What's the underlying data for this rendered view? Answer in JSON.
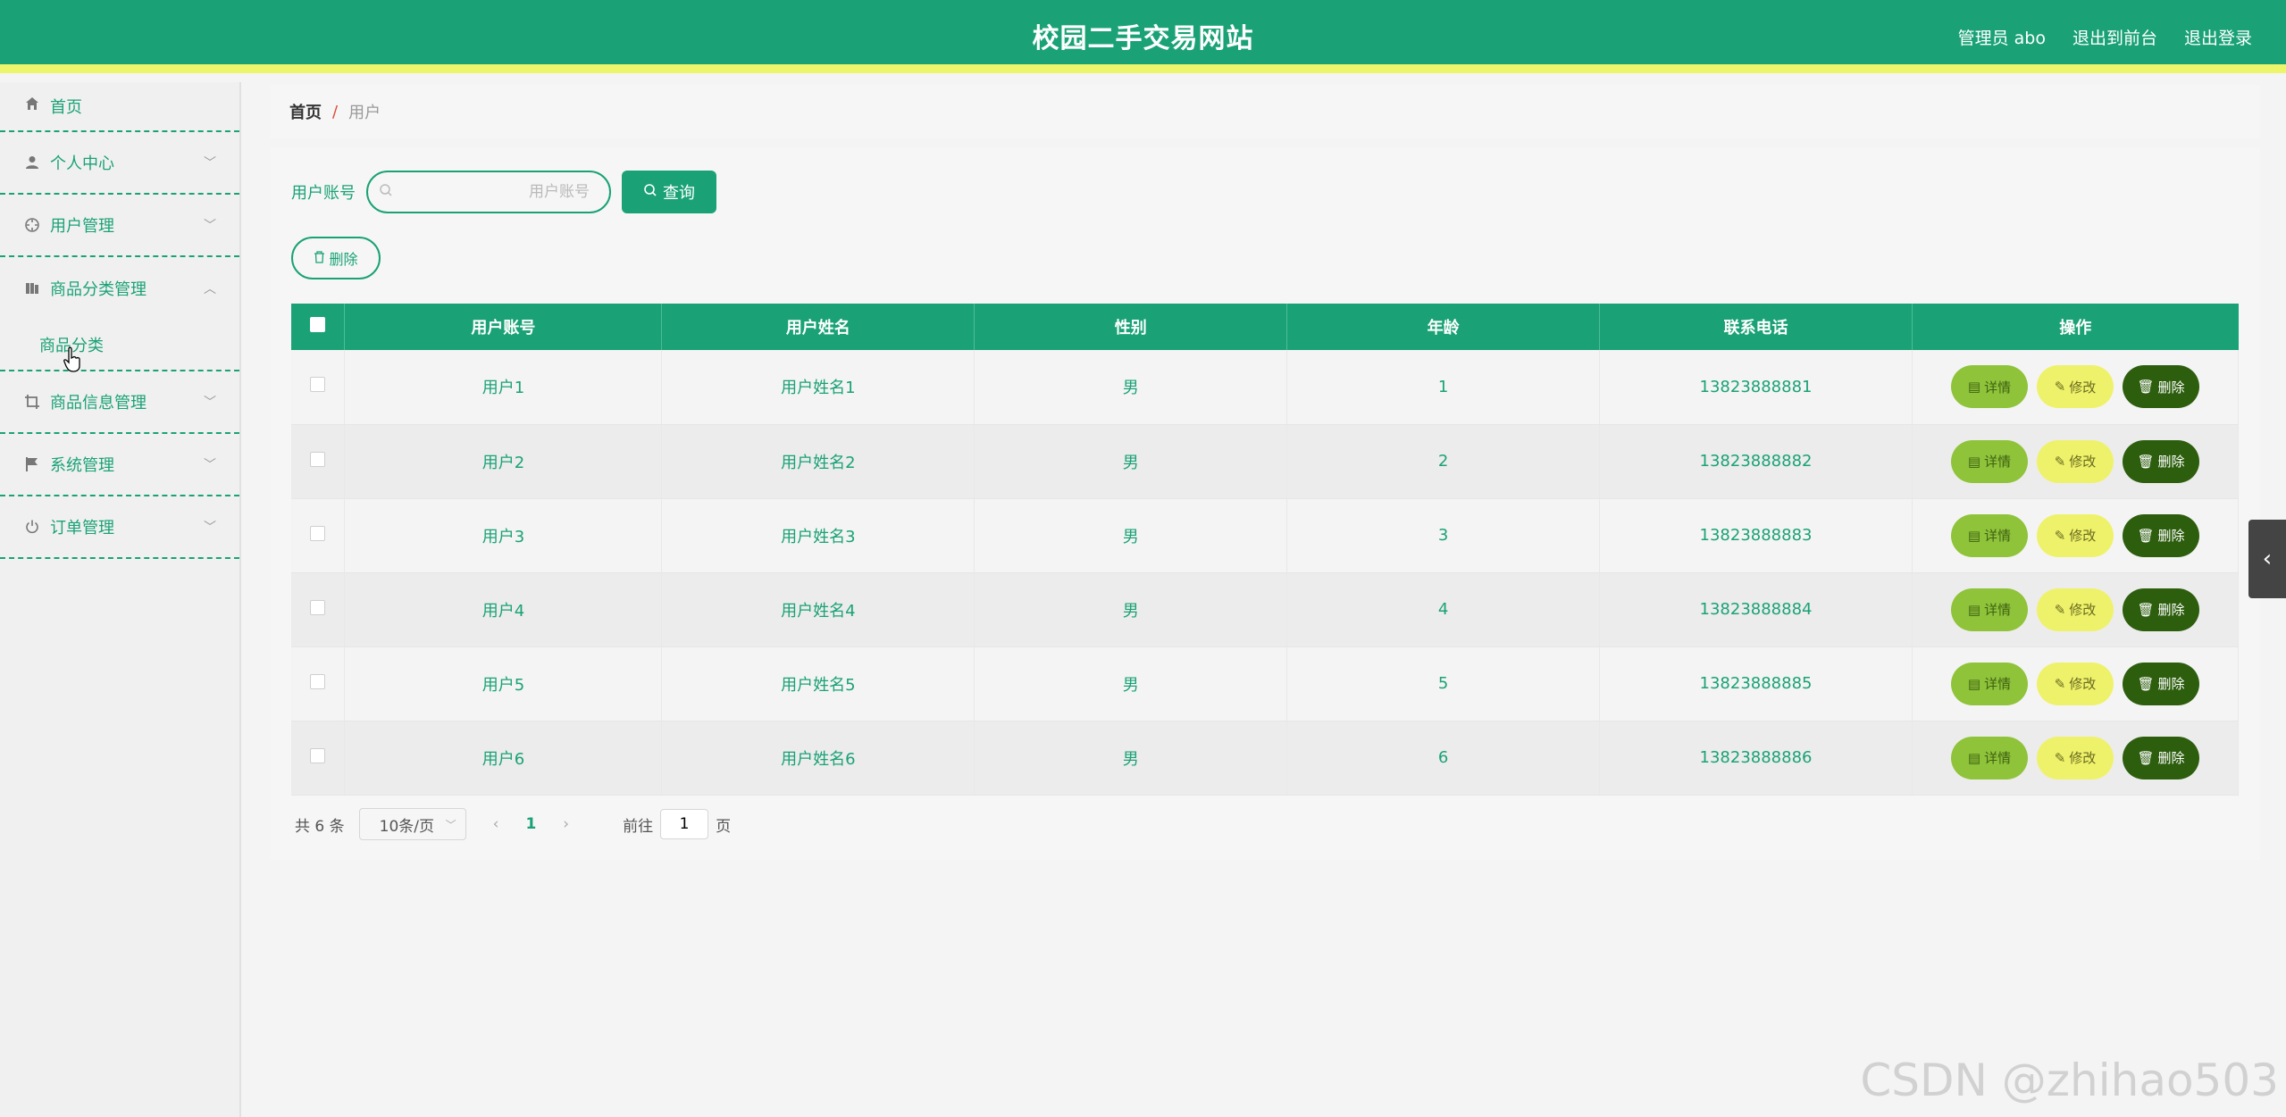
{
  "header": {
    "title": "校园二手交易网站",
    "admin": "管理员 abo",
    "to_front": "退出到前台",
    "logout": "退出登录"
  },
  "sidebar": {
    "items": [
      {
        "label": "首页",
        "icon": "home-icon"
      },
      {
        "label": "个人中心",
        "icon": "user-icon"
      },
      {
        "label": "用户管理",
        "icon": "compass-icon"
      },
      {
        "label": "商品分类管理",
        "icon": "books-icon"
      },
      {
        "label": "商品信息管理",
        "icon": "crop-icon"
      },
      {
        "label": "系统管理",
        "icon": "flag-icon"
      },
      {
        "label": "订单管理",
        "icon": "power-icon"
      }
    ],
    "sub_item": "商品分类"
  },
  "breadcrumb": {
    "home": "首页",
    "separator": "/",
    "current": "用户"
  },
  "search": {
    "label": "用户账号",
    "placeholder": "用户账号",
    "query_button": "查询"
  },
  "toolbar": {
    "delete_label": "删除"
  },
  "table": {
    "columns": [
      "用户账号",
      "用户姓名",
      "性别",
      "年龄",
      "联系电话",
      "操作"
    ],
    "rows": [
      {
        "account": "用户1",
        "name": "用户姓名1",
        "gender": "男",
        "age": "1",
        "phone": "13823888881"
      },
      {
        "account": "用户2",
        "name": "用户姓名2",
        "gender": "男",
        "age": "2",
        "phone": "13823888882"
      },
      {
        "account": "用户3",
        "name": "用户姓名3",
        "gender": "男",
        "age": "3",
        "phone": "13823888883"
      },
      {
        "account": "用户4",
        "name": "用户姓名4",
        "gender": "男",
        "age": "4",
        "phone": "13823888884"
      },
      {
        "account": "用户5",
        "name": "用户姓名5",
        "gender": "男",
        "age": "5",
        "phone": "13823888885"
      },
      {
        "account": "用户6",
        "name": "用户姓名6",
        "gender": "男",
        "age": "6",
        "phone": "13823888886"
      }
    ],
    "actions": {
      "detail": "详情",
      "edit": "修改",
      "delete": "删除"
    }
  },
  "pager": {
    "total": "共 6 条",
    "page_size": "10条/页",
    "current_page": "1",
    "goto_prefix": "前往",
    "goto_value": "1",
    "goto_suffix": "页"
  },
  "watermark": "CSDN @zhihao503",
  "colors": {
    "primary": "#1aa276",
    "header_stripe": "#edf56b",
    "detail": "#8fc33a",
    "edit": "#eef26a",
    "delete": "#2d5e0e"
  }
}
